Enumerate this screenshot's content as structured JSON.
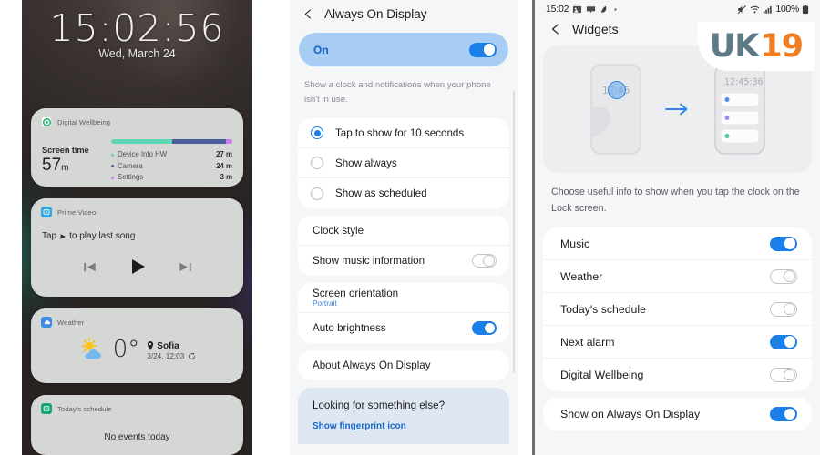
{
  "lockscreen": {
    "clock": "15:02:56",
    "date": "Wed, March 24",
    "widgets": {
      "digital_wellbeing": {
        "title": "Digital Wellbeing",
        "screen_time_label": "Screen time",
        "screen_time_value": "57",
        "screen_time_unit": "m",
        "apps": [
          {
            "name": "Device Info HW",
            "time": "27 m",
            "color": "#5ed6b5",
            "minutes": 27
          },
          {
            "name": "Camera",
            "time": "24 m",
            "color": "#4d5c9e",
            "minutes": 24
          },
          {
            "name": "Settings",
            "time": "3 m",
            "color": "#c97ef0",
            "minutes": 3
          }
        ]
      },
      "prime_video": {
        "title": "Prime Video",
        "message_before": "Tap",
        "message_after": "to play last song"
      },
      "weather": {
        "title": "Weather",
        "temperature": "0°",
        "city": "Sofia",
        "updated": "3/24, 12:03"
      },
      "todays_schedule": {
        "title": "Today's schedule",
        "empty_text": "No events today"
      }
    }
  },
  "aod_settings": {
    "back_label": "Back",
    "title": "Always On Display",
    "master_toggle": {
      "label": "On",
      "state": "on"
    },
    "description": "Show a clock and notifications when your phone isn't in use.",
    "radio_options": [
      {
        "label": "Tap to show for 10 seconds",
        "selected": true
      },
      {
        "label": "Show always",
        "selected": false
      },
      {
        "label": "Show as scheduled",
        "selected": false
      }
    ],
    "rows": [
      {
        "label": "Clock style",
        "control": "none"
      },
      {
        "label": "Show music information",
        "control": "toggle",
        "state": "off"
      }
    ],
    "rows2": [
      {
        "label": "Screen orientation",
        "sub": "Portrait",
        "control": "none"
      },
      {
        "label": "Auto brightness",
        "control": "toggle",
        "state": "on"
      }
    ],
    "rows3": [
      {
        "label": "About Always On Display",
        "control": "none"
      }
    ],
    "footer": {
      "question": "Looking for something else?",
      "link": "Show fingerprint icon"
    }
  },
  "widgets_screen": {
    "statusbar": {
      "time": "15:02",
      "battery": "100%",
      "left_icons": [
        "image-icon",
        "message-icon",
        "app-icon",
        "dot-icon"
      ],
      "right_icons": [
        "mute-icon",
        "wifi-icon",
        "signal-icon",
        "battery-icon"
      ]
    },
    "back_label": "Back",
    "title": "Widgets",
    "hero": {
      "before_clock": "12:45",
      "after_clock": "12:45:36"
    },
    "description": "Choose useful info to show when you tap the clock on the Lock screen.",
    "items": [
      {
        "label": "Music",
        "state": "on"
      },
      {
        "label": "Weather",
        "state": "off"
      },
      {
        "label": "Today's schedule",
        "state": "off"
      },
      {
        "label": "Next alarm",
        "state": "on"
      },
      {
        "label": "Digital Wellbeing",
        "state": "off"
      }
    ],
    "aod_row": {
      "label": "Show on Always On Display",
      "state": "on"
    },
    "watermark": {
      "part1": "UK",
      "part2": "19"
    }
  },
  "colors": {
    "accent_blue": "#1a7fe8",
    "link_blue": "#1668cc",
    "highlight_bg": "#a7cdf5",
    "panel_bg": "#f5f6f8",
    "card_bg": "#ffffff",
    "orange": "#f07e22",
    "teal_logo": "#5d7b85"
  },
  "chart_data": {
    "type": "bar",
    "title": "Screen time",
    "categories": [
      "Device Info HW",
      "Camera",
      "Settings"
    ],
    "values": [
      27,
      24,
      3
    ],
    "unit": "m",
    "total": 57,
    "colors": [
      "#5ed6b5",
      "#4d5c9e",
      "#c97ef0"
    ],
    "xlabel": "",
    "ylabel": "",
    "legend": "inline-list",
    "grid": false
  }
}
